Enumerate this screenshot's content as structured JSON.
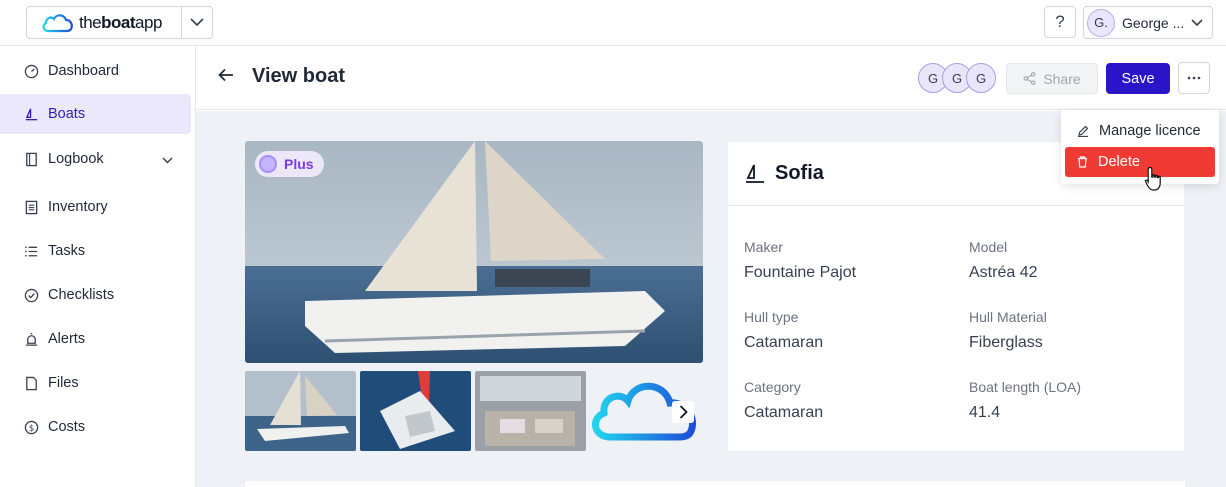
{
  "topbar": {
    "logo_prefix": "the",
    "logo_bold": "boat",
    "logo_suffix": "app",
    "help_label": "?",
    "user_initial": "G.",
    "user_name": "George ..."
  },
  "sidebar": {
    "items": [
      {
        "label": "Dashboard",
        "icon": "gauge-icon"
      },
      {
        "label": "Boats",
        "icon": "sailboat-icon",
        "active": true
      },
      {
        "label": "Logbook",
        "icon": "book-icon"
      },
      {
        "label": "Inventory",
        "icon": "list-box-icon"
      },
      {
        "label": "Tasks",
        "icon": "list-icon"
      },
      {
        "label": "Checklists",
        "icon": "check-circle-icon"
      },
      {
        "label": "Alerts",
        "icon": "alarm-icon"
      },
      {
        "label": "Files",
        "icon": "file-icon"
      },
      {
        "label": "Costs",
        "icon": "dollar-icon"
      }
    ]
  },
  "header": {
    "title": "View boat",
    "collaborators": [
      "G",
      "G",
      "G"
    ],
    "share_label": "Share",
    "save_label": "Save",
    "more_label": "···"
  },
  "menu": {
    "items": [
      {
        "label": "Manage licence",
        "icon": "pencil-icon"
      },
      {
        "label": "Delete",
        "icon": "trash-icon"
      }
    ]
  },
  "gallery": {
    "badge": "Plus"
  },
  "boat": {
    "name": "Sofia",
    "fields": [
      {
        "label": "Maker",
        "value": "Fountaine Pajot"
      },
      {
        "label": "Model",
        "value": "Astréa 42"
      },
      {
        "label": "Hull type",
        "value": "Catamaran"
      },
      {
        "label": "Hull Material",
        "value": "Fiberglass"
      },
      {
        "label": "Category",
        "value": "Catamaran"
      },
      {
        "label": "Boat length (LOA)",
        "value": "41.4"
      }
    ]
  },
  "colors": {
    "primary": "#2a14c8",
    "danger": "#ef3b34",
    "active_bg": "#ebe8fb"
  }
}
